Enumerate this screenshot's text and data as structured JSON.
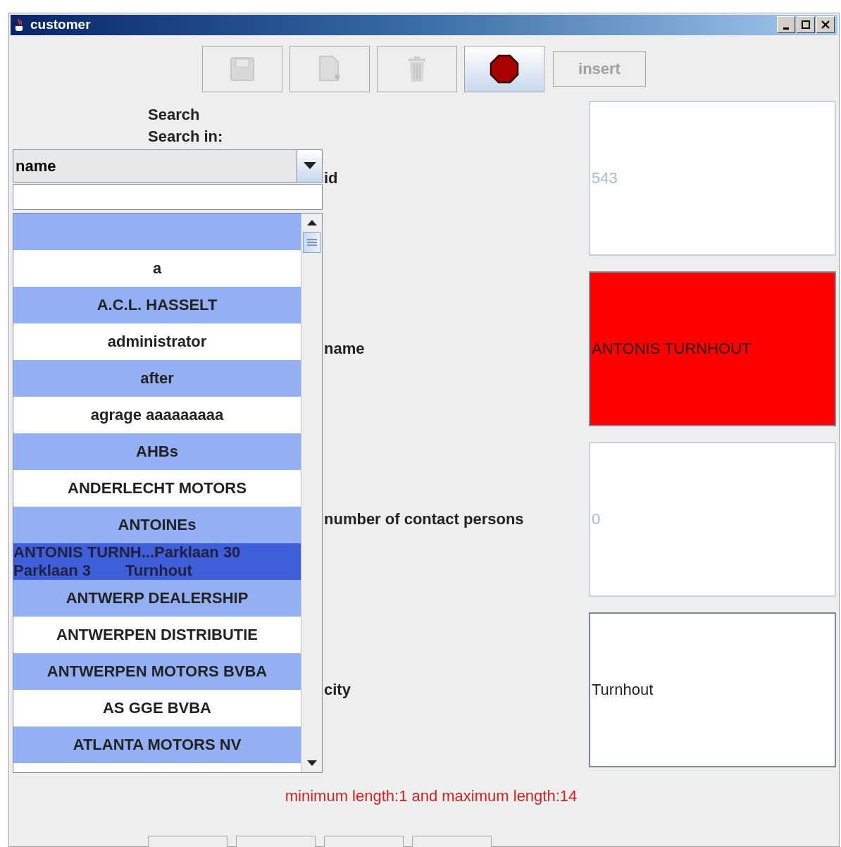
{
  "window": {
    "title": "customer"
  },
  "toolbar": [
    {
      "kind": "save",
      "disabled": true
    },
    {
      "kind": "new",
      "disabled": true
    },
    {
      "kind": "delete",
      "disabled": true
    },
    {
      "kind": "stop",
      "disabled": false
    },
    {
      "kind": "text",
      "label": "insert",
      "disabled": true
    }
  ],
  "search": {
    "title": "Search",
    "search_in_label": "Search in:",
    "field_choice": "name"
  },
  "results": [
    {
      "selected": false
    },
    {
      "label": "a",
      "selected": false
    },
    {
      "label": "A.C.L. HASSELT",
      "selected": false
    },
    {
      "label": "administrator",
      "selected": false
    },
    {
      "label": "after",
      "selected": false
    },
    {
      "label": "agrage aaaaaaaaa",
      "selected": false
    },
    {
      "label": "AHBs",
      "selected": false
    },
    {
      "label": "ANDERLECHT MOTORS",
      "selected": false
    },
    {
      "label": "ANTOINEs",
      "selected": false
    },
    {
      "lines": [
        "ANTONIS TURNH...Parklaan 30",
        "Parklaan 3        Turnhout"
      ],
      "selected": true
    },
    {
      "label": "ANTWERP DEALERSHIP",
      "selected": false
    },
    {
      "label": "ANTWERPEN DISTRIBUTIE",
      "selected": false
    },
    {
      "label": "ANTWERPEN MOTORS BVBA",
      "selected": false
    },
    {
      "label": "AS GGE BVBA",
      "selected": false
    },
    {
      "label": "ATLANTA MOTORS NV",
      "selected": false
    }
  ],
  "fields": [
    {
      "label": "id",
      "value": "543",
      "editable": false,
      "valid": true
    },
    {
      "label": "name",
      "value": "ANTONIS TURNHOUT",
      "editable": true,
      "valid": false
    },
    {
      "label": "number of contact persons",
      "value": "0",
      "editable": false,
      "valid": true
    },
    {
      "label": "city",
      "value": "Turnhout",
      "editable": true,
      "valid": true
    }
  ],
  "message": "minimum length:1 and maximum length:14"
}
